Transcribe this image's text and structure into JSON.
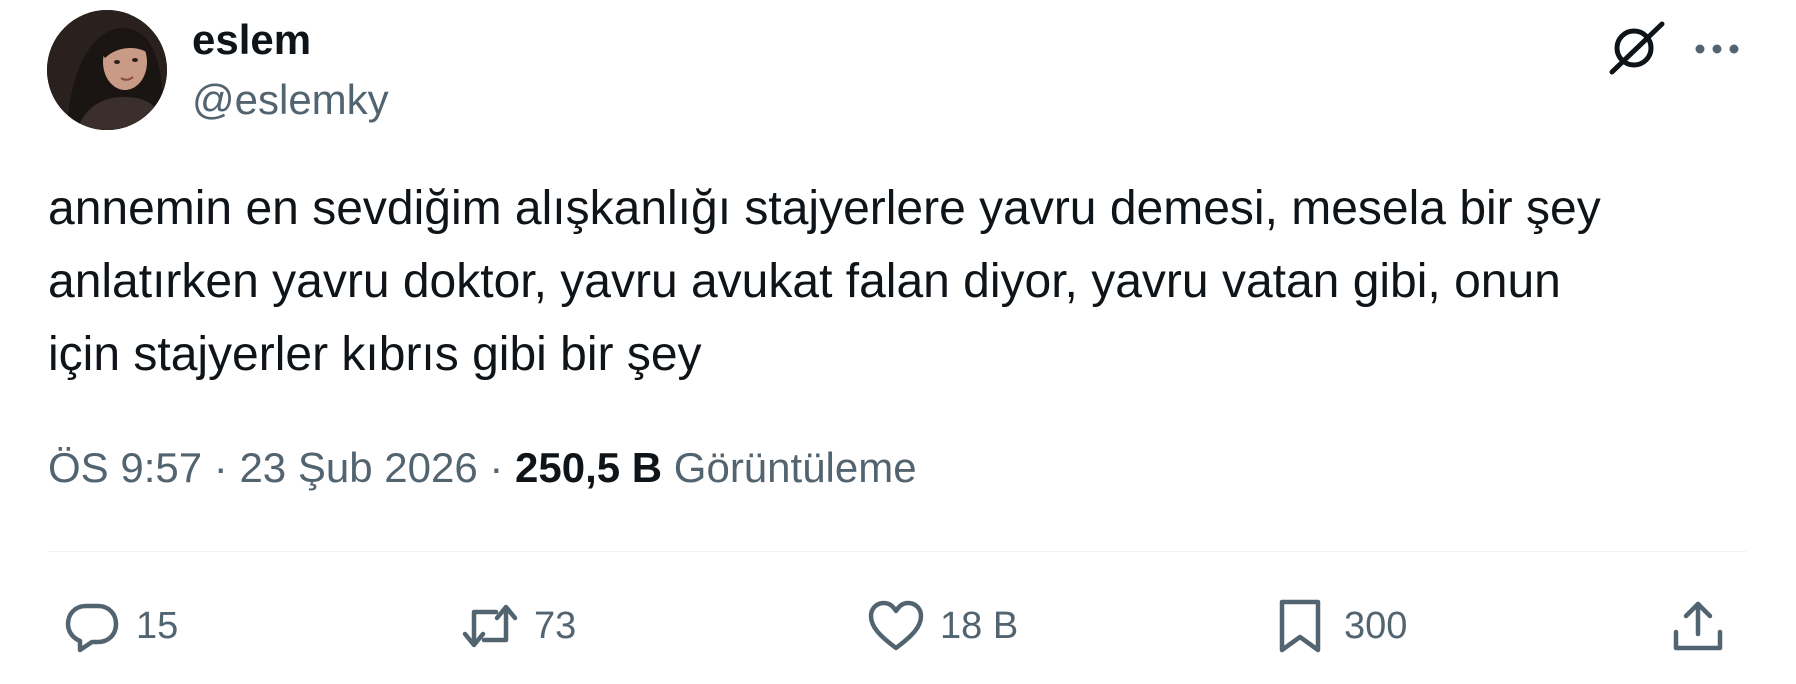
{
  "author": {
    "display_name": "eslem",
    "handle": "@eslemky"
  },
  "tweet": {
    "text": "annemin en sevdiğim alışkanlığı stajyerlere yavru demesi, mesela bir şey\nanlatırken yavru doktor, yavru avukat falan diyor, yavru vatan gibi, onun\niçin stajyerler kıbrıs gibi bir şey"
  },
  "meta": {
    "time": "ÖS 9:57",
    "separator": "·",
    "date": "23 Şub 2026",
    "views_count": "250,5 B",
    "views_label": "Görüntüleme"
  },
  "actions": {
    "replies": "15",
    "retweets": "73",
    "likes": "18 B",
    "bookmarks": "300"
  },
  "icons": {
    "grok": "grok-icon",
    "more": "more-options-icon",
    "reply": "reply-icon",
    "retweet": "retweet-icon",
    "like": "heart-icon",
    "bookmark": "bookmark-icon",
    "share": "share-icon"
  },
  "colors": {
    "text": "#0f1419",
    "secondary": "#536471",
    "divider": "#eff3f4"
  }
}
